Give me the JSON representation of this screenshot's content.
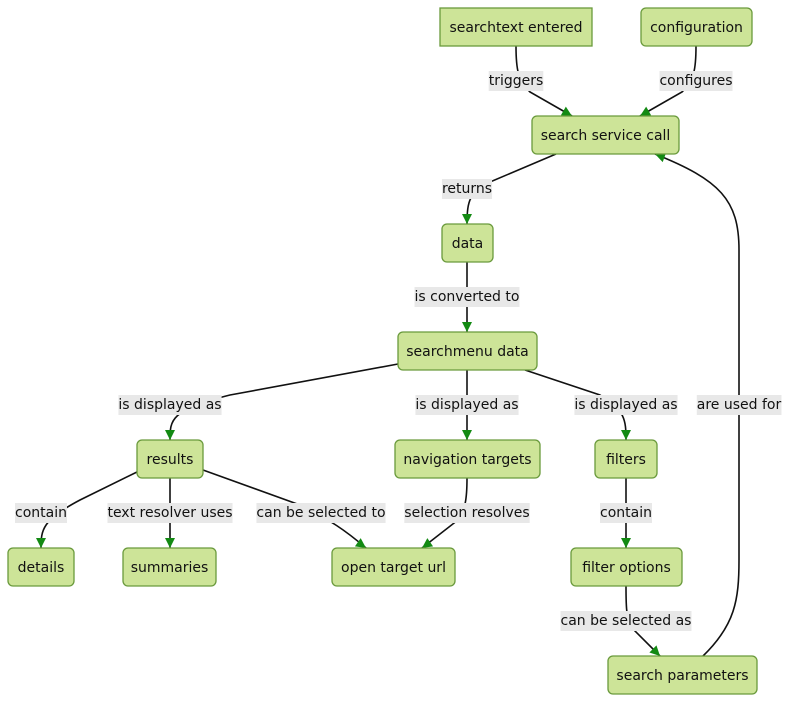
{
  "diagram": {
    "type": "flowchart",
    "colors": {
      "node_fill": "#cde498",
      "node_stroke": "#6a9a3c",
      "edge": "#111111",
      "arrowhead": "#138a13",
      "label_bg": "#e8e8e8"
    },
    "nodes": [
      {
        "id": "searchtext",
        "label": "searchtext entered",
        "shape": "rect"
      },
      {
        "id": "configuration",
        "label": "configuration",
        "shape": "round"
      },
      {
        "id": "service",
        "label": "search service call",
        "shape": "round"
      },
      {
        "id": "data",
        "label": "data",
        "shape": "round"
      },
      {
        "id": "menudata",
        "label": "searchmenu data",
        "shape": "round"
      },
      {
        "id": "results",
        "label": "results",
        "shape": "round"
      },
      {
        "id": "navtargets",
        "label": "navigation targets",
        "shape": "round"
      },
      {
        "id": "filters",
        "label": "filters",
        "shape": "round"
      },
      {
        "id": "details",
        "label": "details",
        "shape": "round"
      },
      {
        "id": "summaries",
        "label": "summaries",
        "shape": "round"
      },
      {
        "id": "opentarget",
        "label": "open target url",
        "shape": "round"
      },
      {
        "id": "filteroptions",
        "label": "filter options",
        "shape": "round"
      },
      {
        "id": "searchparams",
        "label": "search parameters",
        "shape": "round"
      }
    ],
    "edges": [
      {
        "from": "searchtext",
        "to": "service",
        "label": "triggers"
      },
      {
        "from": "configuration",
        "to": "service",
        "label": "configures"
      },
      {
        "from": "service",
        "to": "data",
        "label": "returns"
      },
      {
        "from": "data",
        "to": "menudata",
        "label": "is converted to"
      },
      {
        "from": "menudata",
        "to": "results",
        "label": "is displayed as"
      },
      {
        "from": "menudata",
        "to": "navtargets",
        "label": "is displayed as"
      },
      {
        "from": "menudata",
        "to": "filters",
        "label": "is displayed as"
      },
      {
        "from": "results",
        "to": "details",
        "label": "contain"
      },
      {
        "from": "results",
        "to": "summaries",
        "label": "text resolver uses"
      },
      {
        "from": "results",
        "to": "opentarget",
        "label": "can be selected to"
      },
      {
        "from": "navtargets",
        "to": "opentarget",
        "label": "selection resolves"
      },
      {
        "from": "filters",
        "to": "filteroptions",
        "label": "contain"
      },
      {
        "from": "filteroptions",
        "to": "searchparams",
        "label": "can be selected as"
      },
      {
        "from": "searchparams",
        "to": "service",
        "label": "are used for"
      }
    ]
  }
}
